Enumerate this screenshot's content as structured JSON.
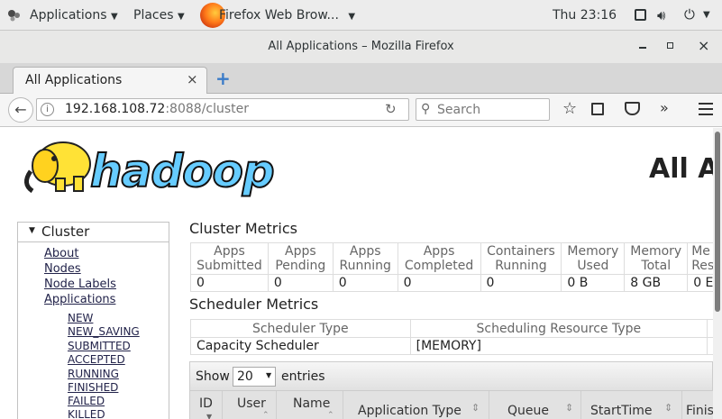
{
  "topbar": {
    "applications": "Applications",
    "places": "Places",
    "active_app": "Firefox Web Brow...",
    "clock": "Thu 23:16"
  },
  "window": {
    "title": "All Applications – Mozilla Firefox"
  },
  "tab": {
    "title": "All Applications",
    "close": "×",
    "new": "+"
  },
  "url": {
    "host": "192.168.108.72",
    "rest": ":8088/cluster"
  },
  "search": {
    "placeholder": "Search"
  },
  "page": {
    "logo_text": "hadoop",
    "heading": "All A",
    "sidebar": {
      "title": "Cluster",
      "links": [
        "About",
        "Nodes",
        "Node Labels",
        "Applications"
      ],
      "states": [
        "NEW",
        "NEW_SAVING",
        "SUBMITTED",
        "ACCEPTED",
        "RUNNING",
        "FINISHED",
        "FAILED",
        "KILLED"
      ]
    },
    "cluster_metrics": {
      "title": "Cluster Metrics",
      "headers": [
        [
          "Apps",
          "Submitted"
        ],
        [
          "Apps",
          "Pending"
        ],
        [
          "Apps",
          "Running"
        ],
        [
          "Apps",
          "Completed"
        ],
        [
          "Containers",
          "Running"
        ],
        [
          "Memory",
          "Used"
        ],
        [
          "Memory",
          "Total"
        ],
        [
          "Me",
          "Res"
        ]
      ],
      "values": [
        "0",
        "0",
        "0",
        "0",
        "0",
        "0 B",
        "8 GB",
        "0 E"
      ]
    },
    "scheduler_metrics": {
      "title": "Scheduler Metrics",
      "headers": [
        "Scheduler Type",
        "Scheduling Resource Type"
      ],
      "values": [
        "Capacity Scheduler",
        "[MEMORY]"
      ]
    },
    "entries": {
      "show": "Show",
      "count": "20",
      "suffix": "entries"
    },
    "app_columns": [
      "ID",
      "User",
      "Name",
      "Application Type",
      "Queue",
      "StartTime",
      "Finis"
    ]
  }
}
